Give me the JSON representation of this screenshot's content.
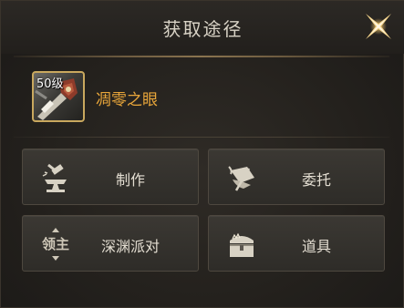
{
  "dialog": {
    "title": "获取途径"
  },
  "item": {
    "level": "50级",
    "name": "凋零之眼"
  },
  "sources": [
    {
      "label": "制作",
      "icon": "anvil-hammer-icon"
    },
    {
      "label": "委托",
      "icon": "scroll-quill-icon"
    },
    {
      "label": "深渊派对",
      "icon": "lord-icon"
    },
    {
      "label": "道具",
      "icon": "treasure-chest-icon"
    }
  ],
  "icons": {
    "lord_icon_text": "领主"
  },
  "colors": {
    "item_name": "#e9a63a",
    "slot_border": "#c9a85e",
    "text": "#e4ded2"
  }
}
